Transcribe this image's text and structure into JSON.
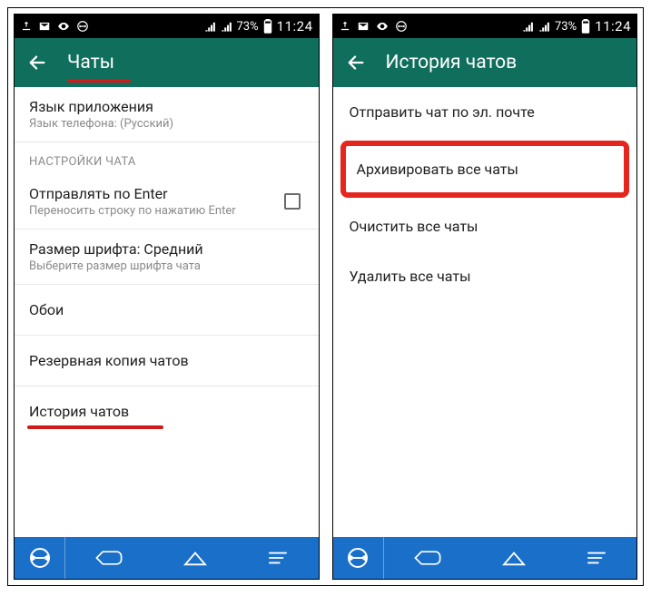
{
  "statusbar": {
    "battery_pct": "73%",
    "clock": "11:24"
  },
  "screen1": {
    "header_title": "Чаты",
    "lang_item": {
      "primary": "Язык приложения",
      "secondary": "Язык телефона: (Русский)"
    },
    "section_chat_settings": "НАСТРОЙКИ ЧАТА",
    "enter_item": {
      "primary": "Отправлять по Enter",
      "secondary": "Переносить строку по нажатию Enter"
    },
    "font_item": {
      "primary": "Размер шрифта: Средний",
      "secondary": "Выберите размер шрифта чата"
    },
    "wallpaper_item": {
      "primary": "Обои"
    },
    "backup_item": {
      "primary": "Резервная копия чатов"
    },
    "history_item": {
      "primary": "История чатов"
    }
  },
  "screen2": {
    "header_title": "История чатов",
    "email_item": {
      "primary": "Отправить чат по эл. почте"
    },
    "archive_item": {
      "primary": "Архивировать все чаты"
    },
    "clear_item": {
      "primary": "Очистить все чаты"
    },
    "delete_item": {
      "primary": "Удалить все чаты"
    }
  }
}
